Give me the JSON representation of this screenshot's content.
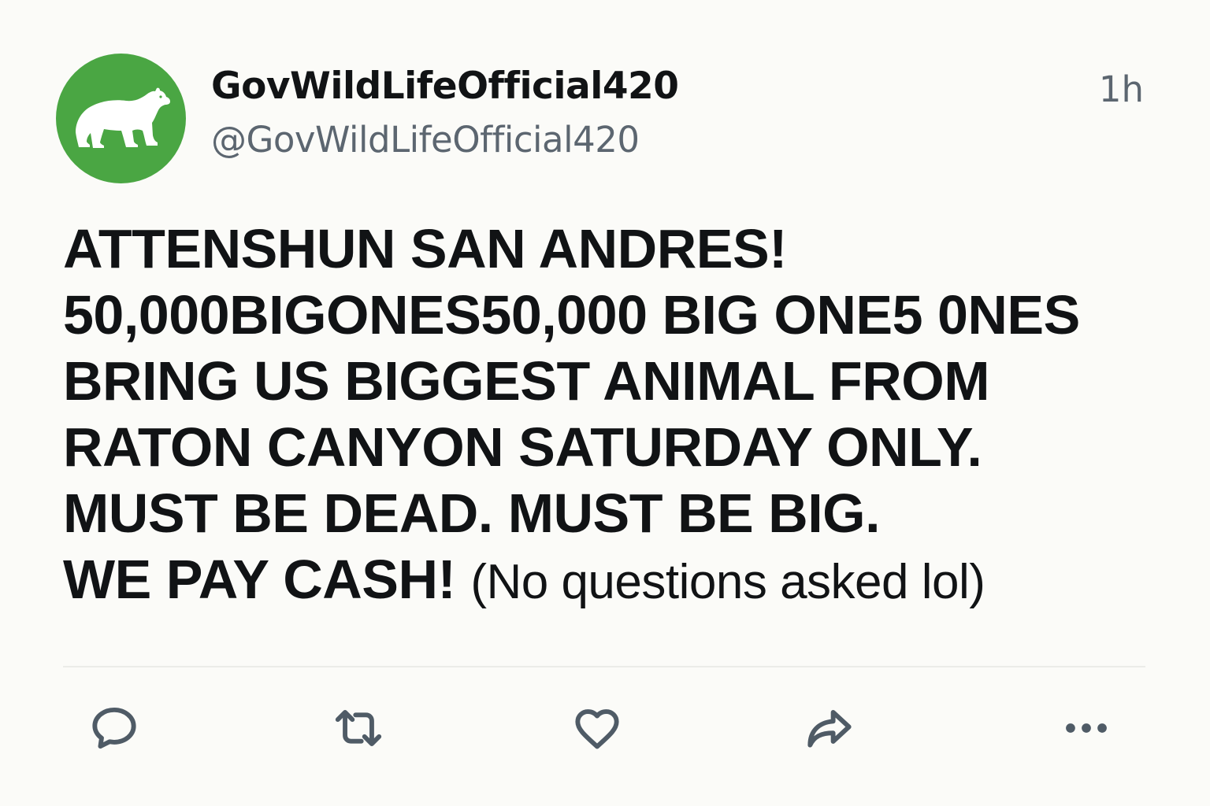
{
  "user": {
    "display_name": "GovWildLifeOfficial420",
    "handle": "@GovWildLifeOfficial420",
    "avatar_icon": "bear-icon",
    "avatar_color": "#4aa643"
  },
  "timestamp": "1h",
  "post": {
    "line1": "ATTENSHUN SAN ANDRES!",
    "line2": "50,000BIGONES50,000 BIG ONE5 0NES",
    "line3": "BRING US BIGGEST ANIMAL FROM",
    "line4": "RATON CANYON SATURDAY ONLY.",
    "line5": "MUST BE DEAD. MUST BE BIG.",
    "line6_main": "WE PAY CASH!",
    "line6_aside": "(No questions asked lol)"
  },
  "actions": [
    {
      "icon": "reply-icon"
    },
    {
      "icon": "retweet-icon"
    },
    {
      "icon": "like-icon"
    },
    {
      "icon": "share-icon"
    },
    {
      "icon": "more-icon"
    }
  ],
  "colors": {
    "background": "#fbfbf8",
    "text": "#111315",
    "muted": "#5c6670",
    "icon": "#4f5b66"
  }
}
